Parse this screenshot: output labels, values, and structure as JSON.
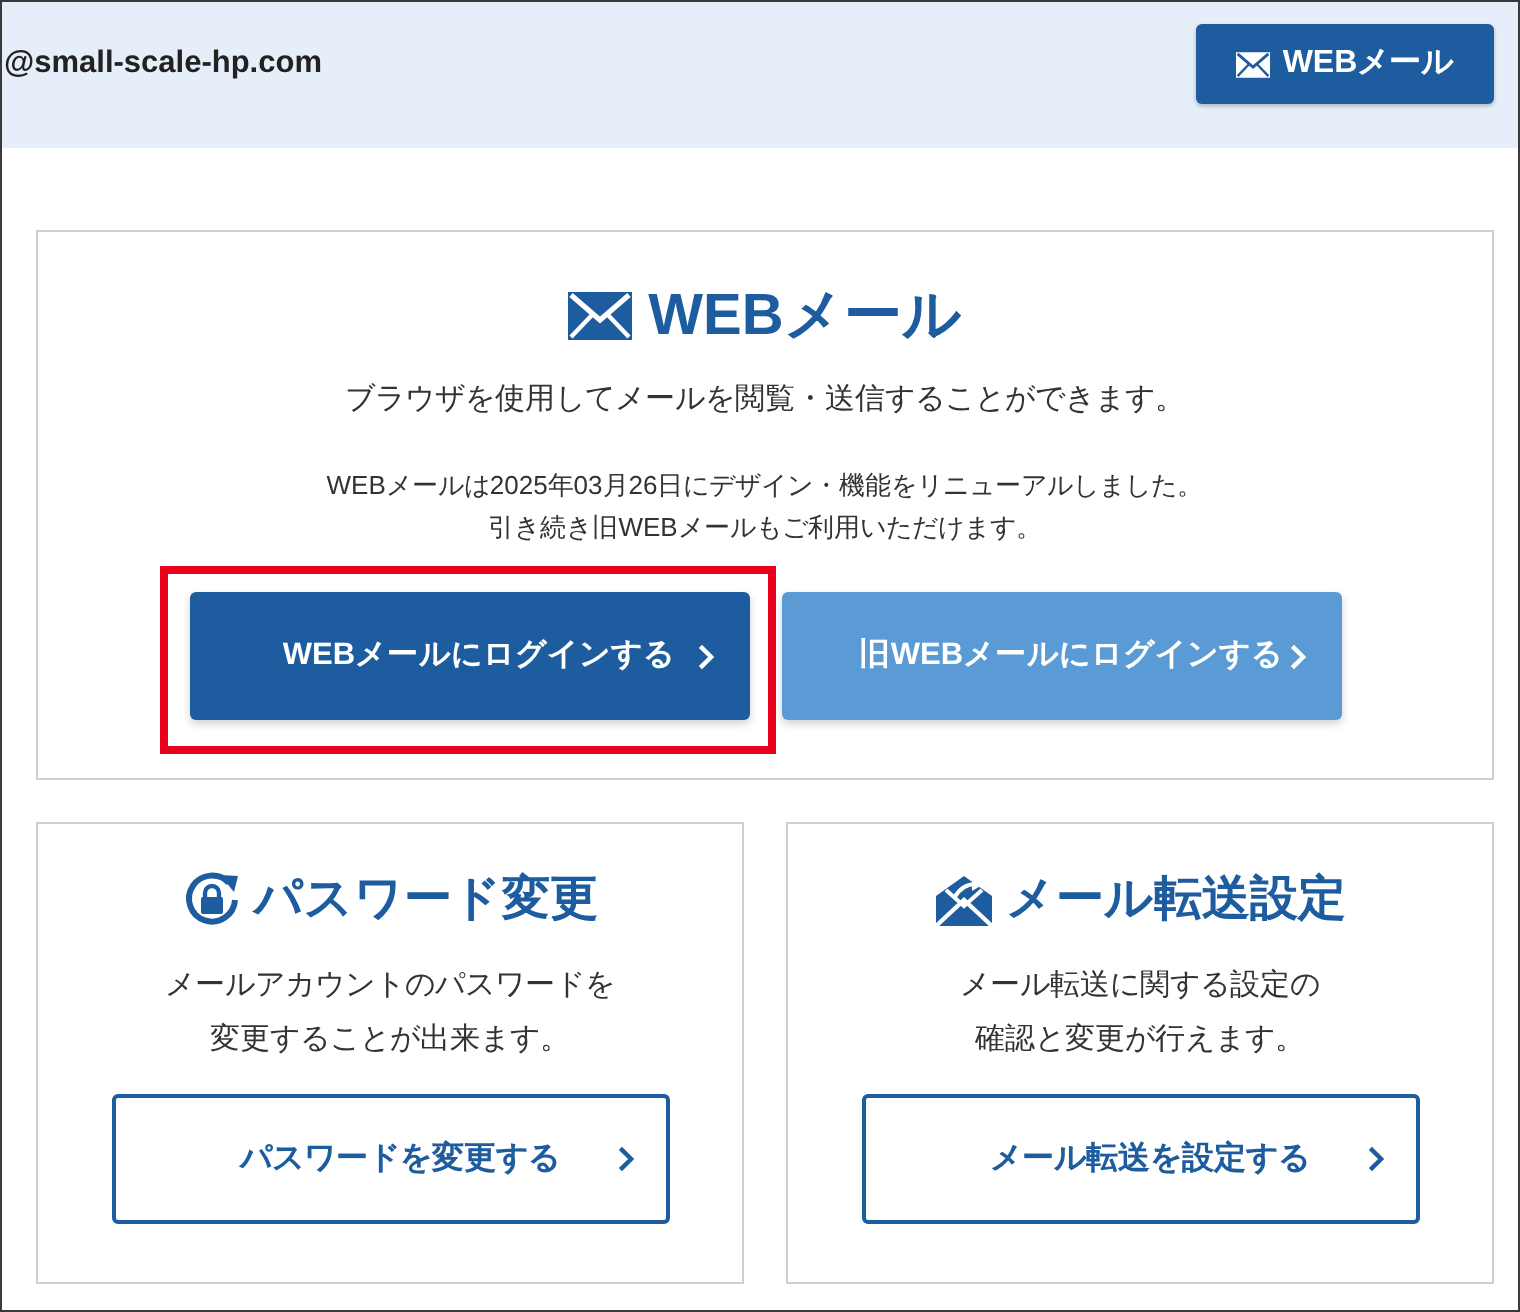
{
  "header": {
    "account": "@small-scale-hp.com",
    "webmail_button": "WEBメール"
  },
  "webmail_panel": {
    "title": "WEBメール",
    "description": "ブラウザを使用してメールを閲覧・送信することができます。",
    "notice": [
      "WEBメールは2025年03月26日にデザイン・機能をリニューアルしました。",
      "引き続き旧WEBメールもご利用いただけます。"
    ],
    "buttons": [
      {
        "label": "WEBメールにログインする",
        "kind": "primary",
        "highlighted": true
      },
      {
        "label": "旧WEBメールにログインする",
        "kind": "secondary",
        "highlighted": false
      }
    ]
  },
  "feature_cards": [
    {
      "kind": "password",
      "title": "パスワード変更",
      "description": [
        "メールアカウントのパスワードを",
        "変更することが出来ます。"
      ],
      "button": "パスワードを変更する"
    },
    {
      "kind": "forwarding",
      "title": "メール転送設定",
      "description": [
        "メール転送に関する設定の",
        "確認と変更が行えます。"
      ],
      "button": "メール転送を設定する"
    }
  ]
}
